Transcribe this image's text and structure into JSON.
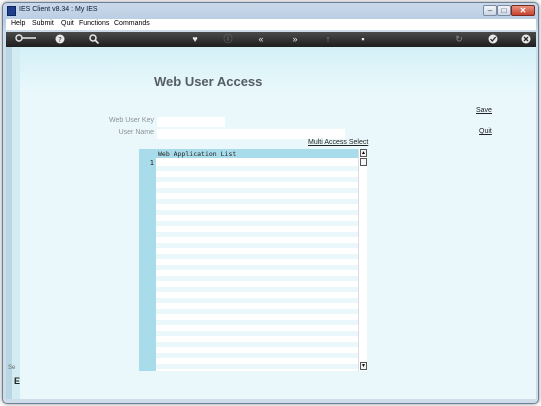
{
  "window": {
    "title": "IES Client v8.34 : My IES"
  },
  "menu": [
    "Help",
    "Submit",
    "Quit",
    "Functions",
    "Commands"
  ],
  "toolbar": {
    "icons": [
      "key-icon",
      "help-icon",
      "search-icon",
      "heart-icon",
      "info-icon",
      "back-icon",
      "forward-icon",
      "up-icon",
      "stop-icon",
      "refresh-icon",
      "check-icon",
      "close-icon"
    ]
  },
  "form": {
    "title": "Web User Access",
    "web_user_key_label": "Web User Key",
    "web_user_key_value": "",
    "user_name_label": "User Name",
    "user_name_value": "",
    "save_label": "Save",
    "quit_label": "Quit",
    "multi_access_label": "Multi Access Select"
  },
  "grid": {
    "column_header": "Web Application List",
    "row_number": "1"
  },
  "fragments": {
    "left_text": "Se",
    "left_bold": "E"
  }
}
